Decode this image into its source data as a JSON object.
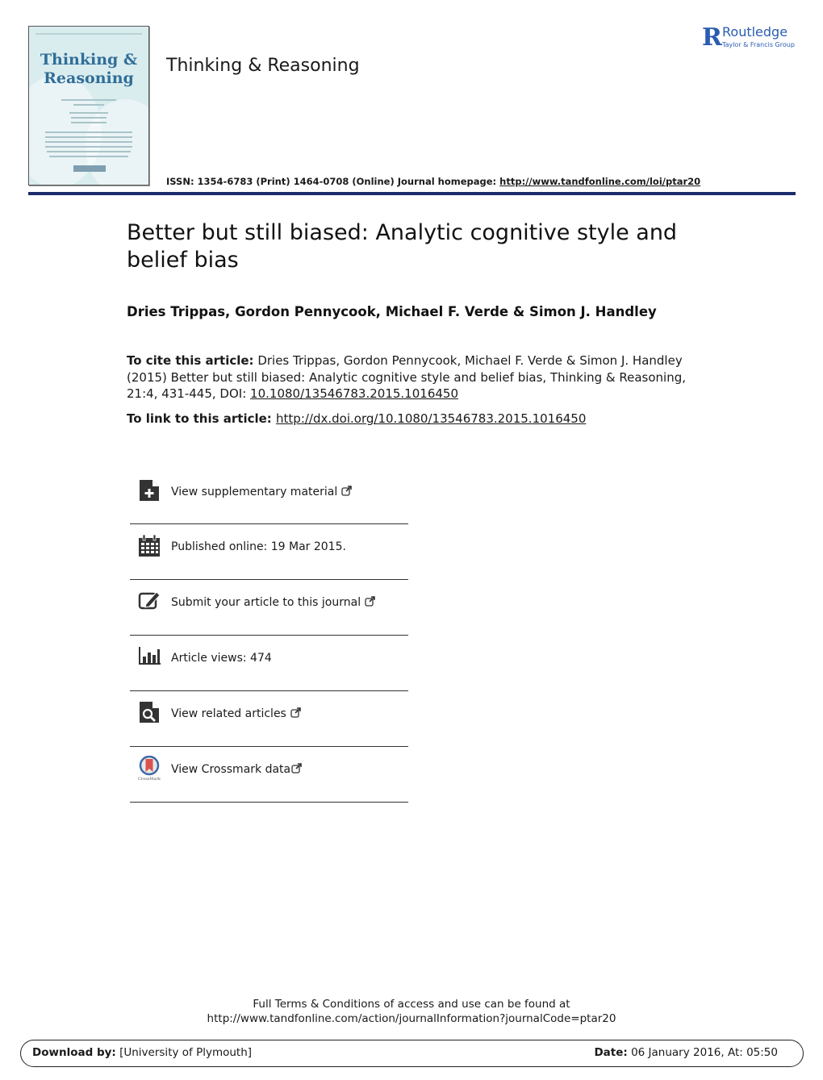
{
  "header": {
    "journal_name": "Thinking & Reasoning",
    "cover": {
      "title_line1": "Thinking &",
      "title_line2": "Reasoning"
    },
    "publisher": {
      "name": "Routledge",
      "group": "Taylor & Francis Group"
    },
    "issn_text": "ISSN: 1354-6783 (Print) 1464-0708 (Online) Journal homepage: ",
    "homepage_url": "http://www.tandfonline.com/loi/ptar20"
  },
  "article": {
    "title": "Better but still biased: Analytic cognitive style and belief bias",
    "authors": "Dries Trippas, Gordon Pennycook, Michael F. Verde & Simon J. Handley",
    "cite_label": "To cite this article:",
    "cite_text": " Dries Trippas, Gordon Pennycook, Michael F. Verde & Simon J. Handley (2015) Better but still biased: Analytic cognitive style and belief bias, Thinking & Reasoning, 21:4, 431-445, DOI: ",
    "doi": "10.1080/13546783.2015.1016450",
    "link_label": "To link to this article: ",
    "link_url": "http://dx.doi.org/10.1080/13546783.2015.1016450"
  },
  "actions": [
    {
      "label": "View supplementary material",
      "icon": "supplementary-file-icon",
      "external": true
    },
    {
      "label": "Published online: 19 Mar 2015.",
      "icon": "calendar-icon",
      "external": false
    },
    {
      "label": "Submit your article to this journal",
      "icon": "edit-icon",
      "external": true
    },
    {
      "label": "Article views: 474",
      "icon": "bar-chart-icon",
      "external": false
    },
    {
      "label": "View related articles",
      "icon": "search-document-icon",
      "external": true
    },
    {
      "label": "View Crossmark data",
      "icon": "crossmark-icon",
      "external": true
    }
  ],
  "footer": {
    "terms_line1": "Full Terms & Conditions of access and use can be found at",
    "terms_line2": "http://www.tandfonline.com/action/journalInformation?journalCode=ptar20",
    "download_label": "Download by:",
    "download_value": " [University of Plymouth]",
    "date_label": "Date:",
    "date_value": " 06 January 2016, At: 05:50"
  },
  "colors": {
    "rule": "#1c2c6b",
    "publisher": "#2a5db0",
    "cover_bg": "#d9ecee",
    "cover_title": "#2f6e98"
  }
}
